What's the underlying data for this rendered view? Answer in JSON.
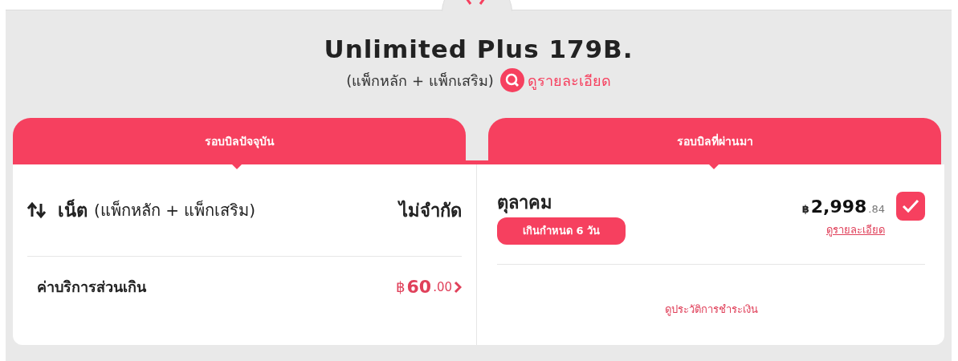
{
  "package": {
    "title": "Unlimited Plus 179B.",
    "subtitle": "(แพ็กหลัก + แพ็กเสริม)",
    "details_link": "ดูรายละเอียด"
  },
  "current_bill": {
    "tab": "รอบบิลปัจจุบัน",
    "net": {
      "label": "เน็ต",
      "note": "(แพ็กหลัก + แพ็กเสริม)",
      "value": "ไม่จำกัด"
    },
    "overage": {
      "label": "ค่าบริการส่วนเกิน",
      "currency": "฿",
      "amount": "60",
      "decimals": ".00"
    }
  },
  "past_bill": {
    "tab": "รอบบิลที่ผ่านมา",
    "month": "ตุลาคม",
    "overdue_badge": "เกินกำหนด 6 วัน",
    "currency": "฿",
    "amount": "2,998",
    "decimals": ".84",
    "details_link": "ดูรายละเอียด",
    "checked": true,
    "history_link": "ดูประวัติการชำระเงิน"
  }
}
